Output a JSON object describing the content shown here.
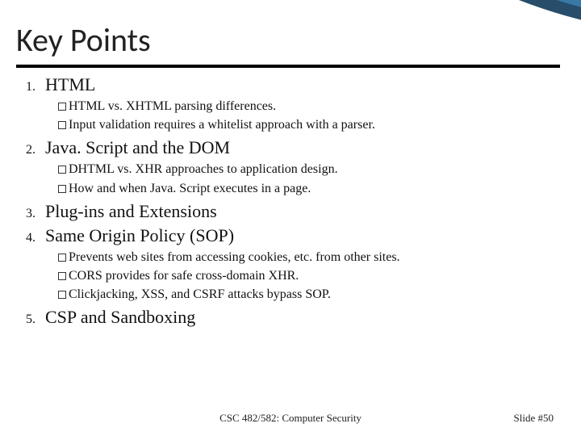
{
  "title": "Key Points",
  "items": [
    {
      "num": "1.",
      "title": "HTML",
      "subs": [
        "HTML vs. XHTML parsing differences.",
        "Input validation requires a whitelist approach with a parser."
      ]
    },
    {
      "num": "2.",
      "title": "Java. Script and the DOM",
      "subs": [
        "DHTML vs. XHR approaches to application design.",
        "How and when Java. Script executes in a page."
      ]
    },
    {
      "num": "3.",
      "title": "Plug-ins and Extensions",
      "subs": []
    },
    {
      "num": "4.",
      "title": "Same Origin Policy (SOP)",
      "subs": [
        "Prevents web sites from accessing cookies, etc. from other sites.",
        "CORS provides for safe cross-domain XHR.",
        "Clickjacking, XSS, and CSRF attacks bypass SOP."
      ]
    },
    {
      "num": "5.",
      "title": "CSP and Sandboxing",
      "subs": []
    }
  ],
  "footer": {
    "center": "CSC 482/582: Computer Security",
    "right": "Slide #50"
  },
  "colors": {
    "arc1": "#1a5a8a",
    "arc2": "#5fa8d3",
    "arc3": "#a8d0e6"
  }
}
